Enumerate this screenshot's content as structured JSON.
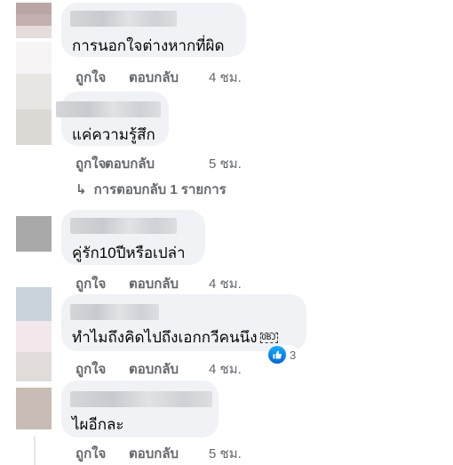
{
  "comments": [
    {
      "text": "การนอกใจต่างหากที่ผิด",
      "like_label": "ถูกใจ",
      "reply_label": "ตอบกลับ",
      "time": "4 ชม."
    },
    {
      "text": "แค่ความรู้สึก",
      "like_label": "ถูกใจ",
      "reply_label": "ตอบกลับ",
      "time": "5 ชม.",
      "replies_link": "การตอบกลับ 1 รายการ"
    },
    {
      "text": "คู่รัก10ปีหรือเปล่า",
      "like_label": "ถูกใจ",
      "reply_label": "ตอบกลับ",
      "time": "4 ชม."
    },
    {
      "text": "ทำไมถึงคิดไปถึงเอกกวีคนนึง",
      "emoji_text": "OBJ",
      "like_label": "ถูกใจ",
      "reply_label": "ตอบกลับ",
      "time": "4 ชม.",
      "reaction_icon": "like-icon",
      "reaction_count": "3"
    },
    {
      "text": "ไผอีกละ",
      "like_label": "ถูกใจ",
      "reply_label": "ตอบกลับ",
      "time": "5 ชม."
    }
  ],
  "colors": {
    "bubble_bg": "#f0f2f5",
    "secondary_text": "#65676b",
    "like_blue": "#0866ff"
  }
}
